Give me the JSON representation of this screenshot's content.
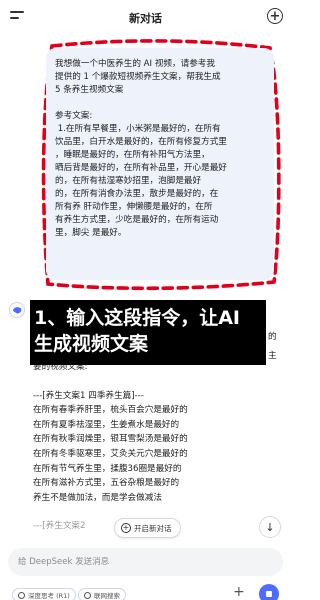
{
  "header": {
    "title": "新对话"
  },
  "user_message": {
    "lines": [
      "我想做一个中医养生的 AI 视频，请参考我",
      "提供的 1 个爆款短视频养生文案，帮我生成",
      "5 条养生视频文案",
      "",
      "参考文案:",
      " 1.在所有早餐里，小米粥是最好的，在所有",
      "饮品里，白开水是最好的，在所有修复方式里",
      "，睡眠是最好的，在所有补阳气方法里，",
      "晒后背是最好的，在所有补品里，开心是最好",
      "的，在所有祛湿寒妙招里，泡脚是最好",
      "的，在所有消食办法里，散步是最好的，在",
      "所有养 肝动作里，伸懒腰是最好的，在所",
      "有养生方式里，少吃是最好的，在所有运动",
      "里，脚尖 是最好。"
    ]
  },
  "banner": {
    "line1": "1、输入这段指令，让AI",
    "line2": "生成视频文案"
  },
  "peek": {
    "a": "的",
    "b": "主"
  },
  "response": {
    "intro_tail": "要的视频文案:",
    "lines": [
      "---[养生文案1 四季养生篇]---",
      "在所有春季养肝里，梳头百会穴是最好的",
      "在所有夏季祛湿里，生姜煮水是最好的",
      "在所有秋季润燥里，银耳雪梨汤是最好的",
      "在所有冬季驱寒里，艾灸关元穴是最好的",
      "在所有节气养生里，揉腹36圈是最好的",
      "在所有滋补方式里，五谷杂粮是最好的",
      "养生不是做加法，而是学会做减法"
    ],
    "faded_line": "---[养生文案2"
  },
  "floating": {
    "new_topic_label": "开启新对话",
    "scroll_icon": "arrow-down-icon"
  },
  "input": {
    "placeholder": "给 DeepSeek 发送消息"
  },
  "bottom": {
    "deep_label": "深度思考 (R1)",
    "web_label": "联网搜索"
  },
  "colors": {
    "bubble_bg": "#eef2fb",
    "dash_outline": "#e0001b",
    "send_button": "#4d6bfe",
    "banner_bg": "#000000"
  }
}
